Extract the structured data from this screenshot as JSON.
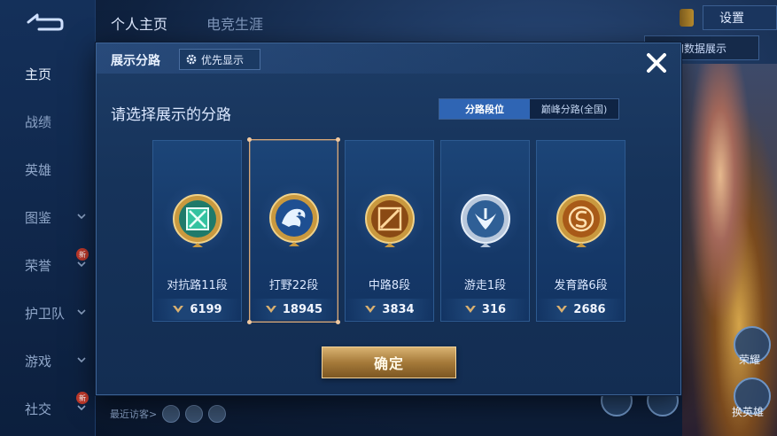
{
  "sidebar": {
    "items": [
      {
        "label": "主页",
        "active": true,
        "chevron": false,
        "new": false
      },
      {
        "label": "战绩",
        "active": false,
        "chevron": false,
        "new": false
      },
      {
        "label": "英雄",
        "active": false,
        "chevron": false,
        "new": false
      },
      {
        "label": "图鉴",
        "active": false,
        "chevron": true,
        "new": false
      },
      {
        "label": "荣誉",
        "active": false,
        "chevron": true,
        "new": true
      },
      {
        "label": "护卫队",
        "active": false,
        "chevron": true,
        "new": false
      },
      {
        "label": "游戏",
        "active": false,
        "chevron": true,
        "new": false
      },
      {
        "label": "社交",
        "active": false,
        "chevron": true,
        "new": true
      }
    ],
    "new_badge": "新"
  },
  "top_tabs": [
    "个人主页",
    "电竞生涯"
  ],
  "top_right": {
    "settings_label": "设置",
    "rank_show_label": "段位和数据展示"
  },
  "right_buttons": {
    "rank_label": "荣耀",
    "change_hero_label": "换英雄"
  },
  "visitors_label": "最近访客>",
  "dialog": {
    "title": "展示分路",
    "priority_label": "优先显示",
    "prompt": "请选择展示的分路",
    "toggle": {
      "on_label": "分路段位",
      "off_label": "巅峰分路(全国)"
    },
    "cards": [
      {
        "rank_label": "对抗路11段",
        "score": "6199",
        "emblem": "clash-lane-emblem-icon",
        "color": "#2aa58a",
        "selected": false
      },
      {
        "rank_label": "打野22段",
        "score": "18945",
        "emblem": "jungle-dragon-emblem-icon",
        "color": "#3d8fd8",
        "selected": true
      },
      {
        "rank_label": "中路8段",
        "score": "3834",
        "emblem": "mid-lane-emblem-icon",
        "color": "#d98a2c",
        "selected": false
      },
      {
        "rank_label": "游走1段",
        "score": "316",
        "emblem": "roam-emblem-icon",
        "color": "#6aa0d0",
        "selected": false
      },
      {
        "rank_label": "发育路6段",
        "score": "2686",
        "emblem": "farm-lane-emblem-icon",
        "color": "#d07a28",
        "selected": false
      }
    ],
    "confirm_label": "确定"
  },
  "colors": {
    "accent_gold": "#d9a877",
    "toggle_active": "#2f65b4",
    "dialog_bg": "#1d3c66"
  }
}
